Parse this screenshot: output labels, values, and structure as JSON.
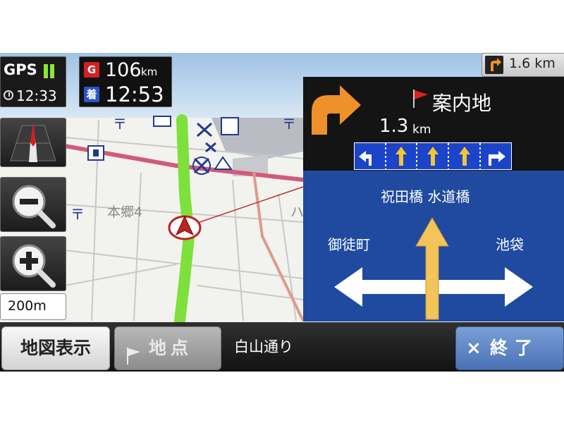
{
  "status": {
    "gps_label": "GPS",
    "current_time": "12:33",
    "remaining_distance_tag": "G",
    "remaining_distance": "106",
    "remaining_distance_unit": "km",
    "arrival_tag": "着",
    "arrival_time": "12:53",
    "next_turn_distance": "1.6 km"
  },
  "map": {
    "area_label": "本郷4",
    "scale": "200m",
    "route_color": "#7ee03a",
    "road_color": "#d25a7a"
  },
  "guidance": {
    "destination_label": "案内地",
    "turn_distance": "1.3",
    "turn_distance_unit": "km",
    "lanes": [
      "left-arrow",
      "straight-arrow",
      "straight-arrow",
      "straight-arrow",
      "right-arrow"
    ],
    "sign_straight": "祝田橋 水道橋",
    "sign_left": "御徒町",
    "sign_right": "池袋"
  },
  "bottom": {
    "map_display_button": "地図表示",
    "point_button": "地点",
    "street_name": "白山通り",
    "end_button_symbol": "×",
    "end_button": "終了"
  },
  "colors": {
    "guide_board": "#1f4aa0",
    "turn_arrow": "#f0902a",
    "end_button": "#5a80c2"
  }
}
